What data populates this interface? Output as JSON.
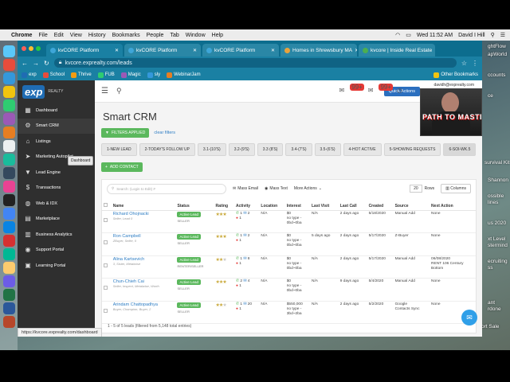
{
  "mac_menu": {
    "app": "Chrome",
    "items": [
      "File",
      "Edit",
      "View",
      "History",
      "Bookmarks",
      "People",
      "Tab",
      "Window",
      "Help"
    ],
    "clock": "Wed 11:52 AM",
    "user": "David I Hill"
  },
  "desktop_labels": [
    "ghtFlow",
    "apWorld",
    "ccounts",
    "ce",
    "survival Kit",
    "Shannon",
    "ossible",
    "lines",
    "us 2020",
    "xt Level",
    "stermind",
    "ecruiting",
    "ss",
    "ant",
    "rdone",
    "ort Sale"
  ],
  "browser": {
    "tabs": [
      {
        "label": "kvCORE Platform",
        "active": true
      },
      {
        "label": "kvCORE Platform",
        "active": false
      },
      {
        "label": "kvCORE Platform",
        "active": false
      },
      {
        "label": "Homes in Shrewsbury MA",
        "active": false
      },
      {
        "label": "kvcore | Inside Real Estate",
        "active": false
      }
    ],
    "url": "kvcore.exprealty.com/leads",
    "bookmarks": [
      "exp",
      "School",
      "Thrive",
      "FUB",
      "Magic",
      "sly",
      "WebinarJam",
      "Other Bookmarks"
    ]
  },
  "sidebar": {
    "logo": "exp",
    "logo_sub": "REALTY",
    "items": [
      {
        "label": "Dashboard",
        "icon": "grid-icon"
      },
      {
        "label": "Smart CRM",
        "icon": "gear-icon"
      },
      {
        "label": "Listings",
        "icon": "home-icon"
      },
      {
        "label": "Marketing Autopilot",
        "icon": "paper-plane-icon"
      },
      {
        "label": "Lead Engine",
        "icon": "funnel-icon"
      },
      {
        "label": "Transactions",
        "icon": "dollar-icon"
      },
      {
        "label": "Web & IDX",
        "icon": "globe-icon"
      },
      {
        "label": "Marketplace",
        "icon": "store-icon"
      },
      {
        "label": "Business Analytics",
        "icon": "chart-icon"
      },
      {
        "label": "Support Portal",
        "icon": "support-icon"
      },
      {
        "label": "Learning Portal",
        "icon": "book-icon"
      }
    ],
    "tooltip": "Dashboard"
  },
  "topbar": {
    "quick_actions": "Quick Actions",
    "badge1": "99+",
    "badge2": "99+",
    "email": "davidh@exprealty.com"
  },
  "page": {
    "title": "Smart CRM",
    "filters_button": "FILTERS APPLIED",
    "clear_filters": "clear filters",
    "views": [
      "1-NEW LEAD",
      "2-TODAY'S FOLLOW UP",
      "3.1-(10'S)",
      "3.2-(9'S)",
      "3.3 (8'S)",
      "3.4-(7'S)",
      "3.5-(6'S)",
      "4-HOT ACTIVE",
      "5-SHOWING REQUESTS",
      "6-SOI-WK.5"
    ],
    "selected_view": 9,
    "add_contact": "ADD CONTACT"
  },
  "tools": {
    "search_placeholder": "Search: (Login to Edit) #",
    "mass_email": "Mass Email",
    "mass_text": "Mass Text",
    "more_actions": "More Actions",
    "rows_value": "20",
    "rows_label": "Rows",
    "columns": "Columns"
  },
  "table": {
    "headers": [
      "Name",
      "Status",
      "Rating",
      "Activity",
      "Location",
      "Interest",
      "Last Visit",
      "Last Call",
      "Created",
      "Source",
      "Next Action"
    ],
    "rows": [
      {
        "name": "Richard Ohojnacki",
        "sub": "Seller, Lead 0",
        "status": "Active Lead",
        "type": "SELLER",
        "rating": 3,
        "calls": "1",
        "emails": "2",
        "msgs": "1",
        "location": "N/A",
        "interest": "$0\nno type -\n0bd~0ba",
        "last_visit": "N/A",
        "last_call": "2 days ago",
        "created": "5/18/2020",
        "source": "Manual Add",
        "next_action": "None"
      },
      {
        "name": "Ron Campbell",
        "sub": "ZBuyer, Seller, 0",
        "status": "Active Lead",
        "type": "SELLER",
        "rating": 3,
        "calls": "1",
        "emails": "2",
        "msgs": "1",
        "location": "N/A",
        "interest": "$0\nno type -\n0bd~0ba",
        "last_visit": "5 days ago",
        "last_call": "2 days ago",
        "created": "5/17/2020",
        "source": "Z-Buyer",
        "next_action": "None"
      },
      {
        "name": "Alina Kartsevich",
        "sub": "3, Sister, Metalwise",
        "status": "Active Lead",
        "type": "RENTER/SELLER",
        "rating": 2,
        "calls": "1",
        "emails": "8",
        "msgs": "1",
        "location": "N/A",
        "interest": "$0\nno type -\n0bd~0ba",
        "last_visit": "N/A",
        "last_call": "2 days ago",
        "created": "5/17/2020",
        "source": "Manual Add",
        "next_action": "06/08/2020\nRENT 106 Century\nBottom"
      },
      {
        "name": "Chun-Chieh Cai",
        "sub": "Seller, Inspect, Metalwise, Worth",
        "status": "Active Lead",
        "type": "SELLER",
        "rating": 3,
        "calls": "2",
        "emails": "4",
        "msgs": "1",
        "location": "N/A",
        "interest": "$0\nno type -\n0bd~0ba",
        "last_visit": "N/A",
        "last_call": "9 days ago",
        "created": "5/4/2020",
        "source": "Manual Add",
        "next_action": "None"
      },
      {
        "name": "Arindam Chattopadhya",
        "sub": "Buyer, Champion, Buyer, 2",
        "status": "Active Lead",
        "type": "SELLER",
        "rating": 2,
        "calls": "1",
        "emails": "20",
        "msgs": "1",
        "location": "N/A",
        "interest": "$550,000\nno type -\n3bd~2ba",
        "last_visit": "N/A",
        "last_call": "2 days ago",
        "created": "5/2/2020",
        "source": "Google\nContacts Sync",
        "next_action": "None"
      }
    ],
    "footer": "1 - 5 of 5 leads (filtered from 5,148 total entries)"
  },
  "status_url": "https://kvcore.exprealty.com/dashboard",
  "webcam_text": "PATH TO MASTERY"
}
